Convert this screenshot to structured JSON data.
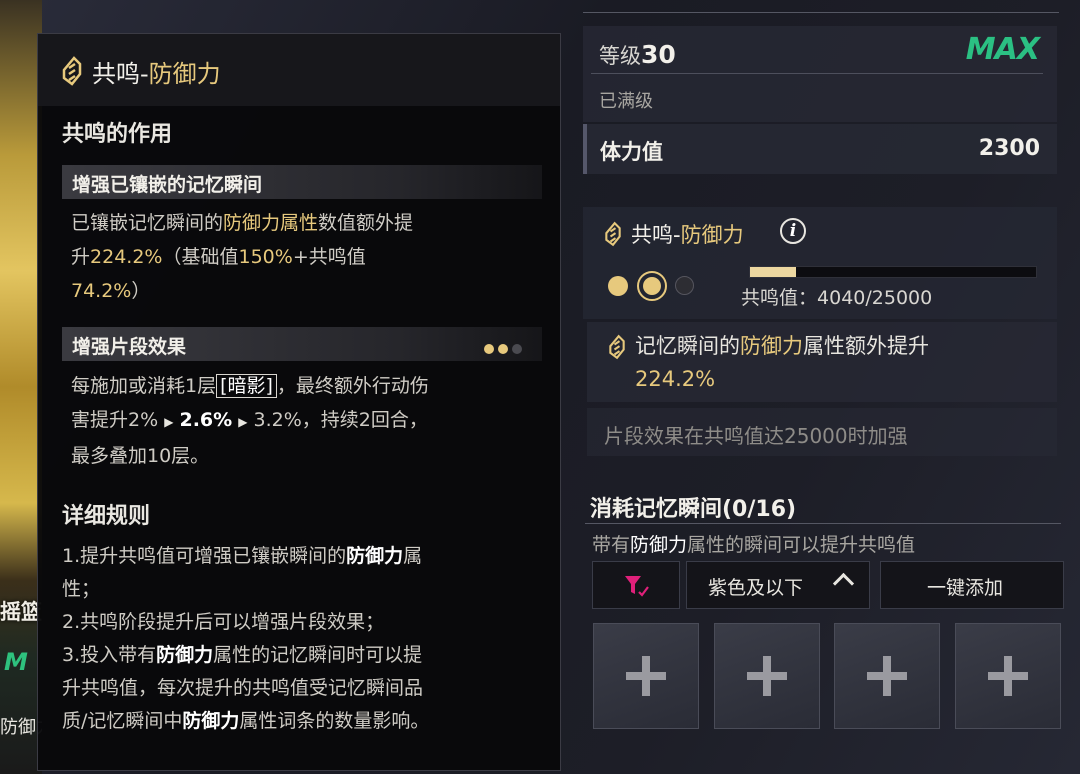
{
  "left_strip": {
    "subtitle": "摇篮曲",
    "badge": "M",
    "attribute": "防御力"
  },
  "tooltip": {
    "title_prefix": "共鸣-",
    "title_attr": "防御力",
    "effect_heading": "共鸣的作用",
    "section1": {
      "title": "增强已镶嵌的记忆瞬间",
      "line1_a": "已镶嵌记忆瞬间的",
      "line1_attr": "防御力属性",
      "line1_b": "数值额外提",
      "line2_a": "升",
      "total": "224.2%",
      "line2_b": "（基础值",
      "base": "150%",
      "line2_c": "+共鸣值",
      "resonance": "74.2%",
      "line3_b": "）"
    },
    "section2": {
      "title": "增强片段效果",
      "line1_a": "每施加或消耗1层",
      "tag": "[暗影]",
      "line1_b": "，最终额外行动伤",
      "line2_a": "害提升2%",
      "mid": "2.6%",
      "line2_b": "3.2%，持续2回合，",
      "line3": "最多叠加10层。"
    },
    "rules": {
      "heading": "详细规则",
      "r1_a": "1.提升共鸣值可增强已镶嵌瞬间的",
      "r1_attr": "防御力",
      "r1_b": "属",
      "r1_c": "性；",
      "r2": "2.共鸣阶段提升后可以增强片段效果；",
      "r3_a": "3.投入带有",
      "r3_attr": "防御力",
      "r3_b": "属性的记忆瞬间时可以提",
      "r3_c": "升共鸣值，每次提升的共鸣值受记忆瞬间品",
      "r3_d": "质/记忆瞬间中",
      "r3_attr2": "防御力",
      "r3_e": "属性词条的数量影响。"
    }
  },
  "right": {
    "level_label": "等级",
    "level_value": "30",
    "max_badge": "MAX",
    "level_status": "已满级",
    "stat_label": "体力值",
    "stat_value": "2300",
    "res_title_prefix": "共鸣-",
    "res_title_attr": "防御力",
    "info_icon": "i",
    "resonance_label": "共鸣值：",
    "resonance_value": "4040/25000",
    "resonance_progress": 0.1616,
    "bonus_a": "记忆瞬间的",
    "bonus_attr": "防御力",
    "bonus_b": "属性额外提升",
    "bonus_value": "224.2%",
    "note": "片段效果在共鸣值达25000时加强",
    "consume_title": "消耗记忆瞬间(0/16)",
    "consume_sub_attr": "带有",
    "consume_sub_attr2": "防御力",
    "consume_sub_b": "属性的瞬间可以提升共鸣值",
    "filter_icon": "filter-icon",
    "quality_label": "紫色及以下",
    "quick_add_label": "一键添加"
  },
  "colors": {
    "gold": "#e7c97d",
    "max_green": "#2bc083",
    "filter_pink": "#e0207a"
  }
}
